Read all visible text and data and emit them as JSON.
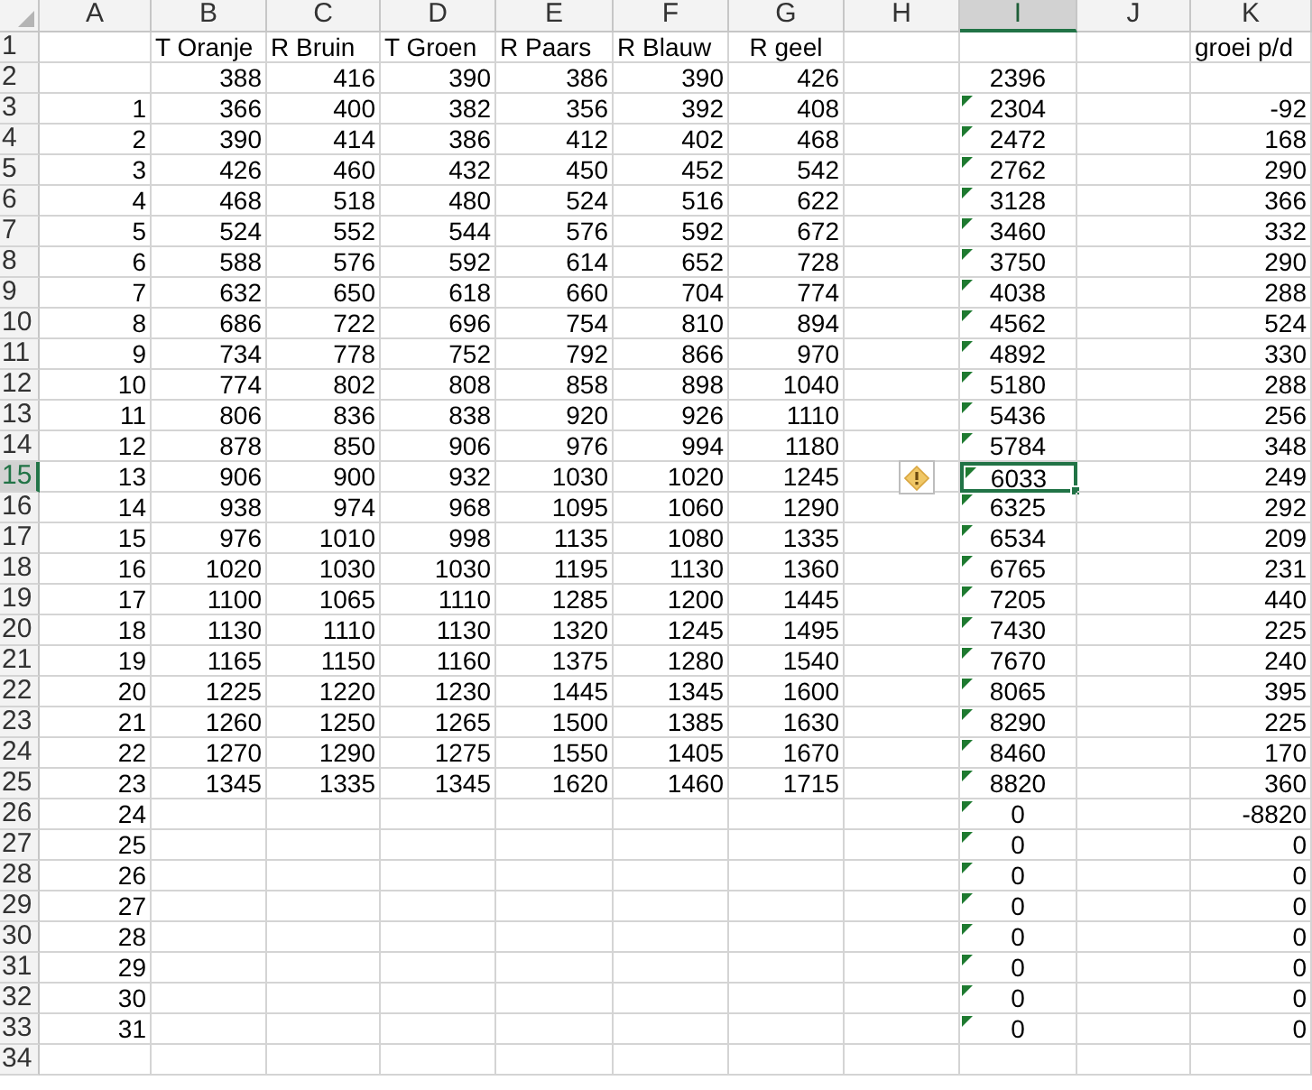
{
  "columns": [
    {
      "label": "A",
      "selected": false
    },
    {
      "label": "B",
      "selected": false
    },
    {
      "label": "C",
      "selected": false
    },
    {
      "label": "D",
      "selected": false
    },
    {
      "label": "E",
      "selected": false
    },
    {
      "label": "F",
      "selected": false
    },
    {
      "label": "G",
      "selected": false
    },
    {
      "label": "H",
      "selected": false
    },
    {
      "label": "I",
      "selected": true
    },
    {
      "label": "J",
      "selected": false
    },
    {
      "label": "K",
      "selected": false
    }
  ],
  "rows": [
    {
      "num": "1",
      "selected": false,
      "flag": false,
      "warning": false,
      "b": "T Oranje",
      "c": "R Bruin",
      "d": "T Groen",
      "e": "R Paars",
      "f": "R Blauw",
      "g": "R geel",
      "k": "groei p/d"
    },
    {
      "num": "2",
      "selected": false,
      "flag": false,
      "warning": false,
      "b": "388",
      "c": "416",
      "d": "390",
      "e": "386",
      "f": "390",
      "g": "426",
      "i": "2396"
    },
    {
      "num": "3",
      "selected": false,
      "flag": true,
      "warning": false,
      "a": "1",
      "b": "366",
      "c": "400",
      "d": "382",
      "e": "356",
      "f": "392",
      "g": "408",
      "i": "2304",
      "k": "-92"
    },
    {
      "num": "4",
      "selected": false,
      "flag": true,
      "warning": false,
      "a": "2",
      "b": "390",
      "c": "414",
      "d": "386",
      "e": "412",
      "f": "402",
      "g": "468",
      "i": "2472",
      "k": "168"
    },
    {
      "num": "5",
      "selected": false,
      "flag": true,
      "warning": false,
      "a": "3",
      "b": "426",
      "c": "460",
      "d": "432",
      "e": "450",
      "f": "452",
      "g": "542",
      "i": "2762",
      "k": "290"
    },
    {
      "num": "6",
      "selected": false,
      "flag": true,
      "warning": false,
      "a": "4",
      "b": "468",
      "c": "518",
      "d": "480",
      "e": "524",
      "f": "516",
      "g": "622",
      "i": "3128",
      "k": "366"
    },
    {
      "num": "7",
      "selected": false,
      "flag": true,
      "warning": false,
      "a": "5",
      "b": "524",
      "c": "552",
      "d": "544",
      "e": "576",
      "f": "592",
      "g": "672",
      "i": "3460",
      "k": "332"
    },
    {
      "num": "8",
      "selected": false,
      "flag": true,
      "warning": false,
      "a": "6",
      "b": "588",
      "c": "576",
      "d": "592",
      "e": "614",
      "f": "652",
      "g": "728",
      "i": "3750",
      "k": "290"
    },
    {
      "num": "9",
      "selected": false,
      "flag": true,
      "warning": false,
      "a": "7",
      "b": "632",
      "c": "650",
      "d": "618",
      "e": "660",
      "f": "704",
      "g": "774",
      "i": "4038",
      "k": "288"
    },
    {
      "num": "10",
      "selected": false,
      "flag": true,
      "warning": false,
      "a": "8",
      "b": "686",
      "c": "722",
      "d": "696",
      "e": "754",
      "f": "810",
      "g": "894",
      "i": "4562",
      "k": "524"
    },
    {
      "num": "11",
      "selected": false,
      "flag": true,
      "warning": false,
      "a": "9",
      "b": "734",
      "c": "778",
      "d": "752",
      "e": "792",
      "f": "866",
      "g": "970",
      "i": "4892",
      "k": "330"
    },
    {
      "num": "12",
      "selected": false,
      "flag": true,
      "warning": false,
      "a": "10",
      "b": "774",
      "c": "802",
      "d": "808",
      "e": "858",
      "f": "898",
      "g": "1040",
      "i": "5180",
      "k": "288"
    },
    {
      "num": "13",
      "selected": false,
      "flag": true,
      "warning": false,
      "a": "11",
      "b": "806",
      "c": "836",
      "d": "838",
      "e": "920",
      "f": "926",
      "g": "1110",
      "i": "5436",
      "k": "256"
    },
    {
      "num": "14",
      "selected": false,
      "flag": true,
      "warning": false,
      "a": "12",
      "b": "878",
      "c": "850",
      "d": "906",
      "e": "976",
      "f": "994",
      "g": "1180",
      "i": "5784",
      "k": "348"
    },
    {
      "num": "15",
      "selected": true,
      "flag": true,
      "warning": true,
      "a": "13",
      "b": "906",
      "c": "900",
      "d": "932",
      "e": "1030",
      "f": "1020",
      "g": "1245",
      "i": "6033",
      "k": "249"
    },
    {
      "num": "16",
      "selected": false,
      "flag": true,
      "warning": false,
      "a": "14",
      "b": "938",
      "c": "974",
      "d": "968",
      "e": "1095",
      "f": "1060",
      "g": "1290",
      "i": "6325",
      "k": "292"
    },
    {
      "num": "17",
      "selected": false,
      "flag": true,
      "warning": false,
      "a": "15",
      "b": "976",
      "c": "1010",
      "d": "998",
      "e": "1135",
      "f": "1080",
      "g": "1335",
      "i": "6534",
      "k": "209"
    },
    {
      "num": "18",
      "selected": false,
      "flag": true,
      "warning": false,
      "a": "16",
      "b": "1020",
      "c": "1030",
      "d": "1030",
      "e": "1195",
      "f": "1130",
      "g": "1360",
      "i": "6765",
      "k": "231"
    },
    {
      "num": "19",
      "selected": false,
      "flag": true,
      "warning": false,
      "a": "17",
      "b": "1100",
      "c": "1065",
      "d": "1110",
      "e": "1285",
      "f": "1200",
      "g": "1445",
      "i": "7205",
      "k": "440"
    },
    {
      "num": "20",
      "selected": false,
      "flag": true,
      "warning": false,
      "a": "18",
      "b": "1130",
      "c": "1110",
      "d": "1130",
      "e": "1320",
      "f": "1245",
      "g": "1495",
      "i": "7430",
      "k": "225"
    },
    {
      "num": "21",
      "selected": false,
      "flag": true,
      "warning": false,
      "a": "19",
      "b": "1165",
      "c": "1150",
      "d": "1160",
      "e": "1375",
      "f": "1280",
      "g": "1540",
      "i": "7670",
      "k": "240"
    },
    {
      "num": "22",
      "selected": false,
      "flag": true,
      "warning": false,
      "a": "20",
      "b": "1225",
      "c": "1220",
      "d": "1230",
      "e": "1445",
      "f": "1345",
      "g": "1600",
      "i": "8065",
      "k": "395"
    },
    {
      "num": "23",
      "selected": false,
      "flag": true,
      "warning": false,
      "a": "21",
      "b": "1260",
      "c": "1250",
      "d": "1265",
      "e": "1500",
      "f": "1385",
      "g": "1630",
      "i": "8290",
      "k": "225"
    },
    {
      "num": "24",
      "selected": false,
      "flag": true,
      "warning": false,
      "a": "22",
      "b": "1270",
      "c": "1290",
      "d": "1275",
      "e": "1550",
      "f": "1405",
      "g": "1670",
      "i": "8460",
      "k": "170"
    },
    {
      "num": "25",
      "selected": false,
      "flag": true,
      "warning": false,
      "a": "23",
      "b": "1345",
      "c": "1335",
      "d": "1345",
      "e": "1620",
      "f": "1460",
      "g": "1715",
      "i": "8820",
      "k": "360"
    },
    {
      "num": "26",
      "selected": false,
      "flag": true,
      "warning": false,
      "a": "24",
      "i": "0",
      "k": "-8820"
    },
    {
      "num": "27",
      "selected": false,
      "flag": true,
      "warning": false,
      "a": "25",
      "i": "0",
      "k": "0"
    },
    {
      "num": "28",
      "selected": false,
      "flag": true,
      "warning": false,
      "a": "26",
      "i": "0",
      "k": "0"
    },
    {
      "num": "29",
      "selected": false,
      "flag": true,
      "warning": false,
      "a": "27",
      "i": "0",
      "k": "0"
    },
    {
      "num": "30",
      "selected": false,
      "flag": true,
      "warning": false,
      "a": "28",
      "i": "0",
      "k": "0"
    },
    {
      "num": "31",
      "selected": false,
      "flag": true,
      "warning": false,
      "a": "29",
      "i": "0",
      "k": "0"
    },
    {
      "num": "32",
      "selected": false,
      "flag": true,
      "warning": false,
      "a": "30",
      "i": "0",
      "k": "0"
    },
    {
      "num": "33",
      "selected": false,
      "flag": true,
      "warning": false,
      "a": "31",
      "i": "0",
      "k": "0"
    },
    {
      "num": "34",
      "selected": false,
      "flag": false,
      "warning": false
    }
  ]
}
